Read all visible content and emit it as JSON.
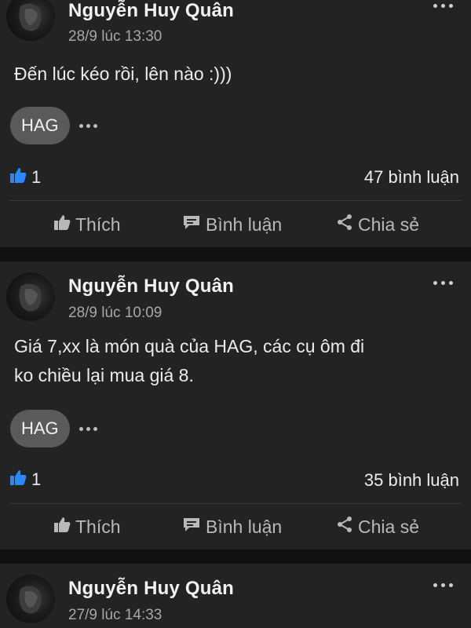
{
  "posts": [
    {
      "author": "Nguyễn Huy Quân",
      "time": "28/9 lúc 13:30",
      "text": [
        "Đến lúc kéo rồi, lên nào :)))"
      ],
      "tag": "HAG",
      "likes": "1",
      "comments": "47 bình luận"
    },
    {
      "author": "Nguyễn Huy Quân",
      "time": "28/9 lúc 10:09",
      "text": [
        "Giá 7,xx là món quà của HAG, các cụ ôm đi",
        "ko chiều lại mua giá 8."
      ],
      "tag": "HAG",
      "likes": "1",
      "comments": "35 bình luận"
    },
    {
      "author": "Nguyễn Huy Quân",
      "time": "27/9 lúc 14:33"
    }
  ],
  "actions": {
    "like": "Thích",
    "comment": "Bình luận",
    "share": "Chia sẻ"
  },
  "icons": {
    "more": "more-icon",
    "like_reaction": "like-reaction-icon",
    "like": "thumbs-up-icon",
    "comment": "comment-icon",
    "share": "share-icon"
  },
  "colors": {
    "background": "#111111",
    "card": "#232323",
    "like_blue": "#2d88ff",
    "tag_bg": "#5a5a5a"
  }
}
